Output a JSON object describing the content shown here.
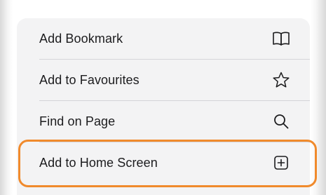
{
  "menu": {
    "items": [
      {
        "label": "Add Bookmark",
        "icon": "book-icon"
      },
      {
        "label": "Add to Favourites",
        "icon": "star-icon"
      },
      {
        "label": "Find on Page",
        "icon": "search-icon"
      },
      {
        "label": "Add to Home Screen",
        "icon": "add-square-icon"
      }
    ]
  },
  "colors": {
    "highlight": "#f08a2c",
    "sheet_background": "#f3f3f4",
    "text": "#1c1c1e"
  }
}
